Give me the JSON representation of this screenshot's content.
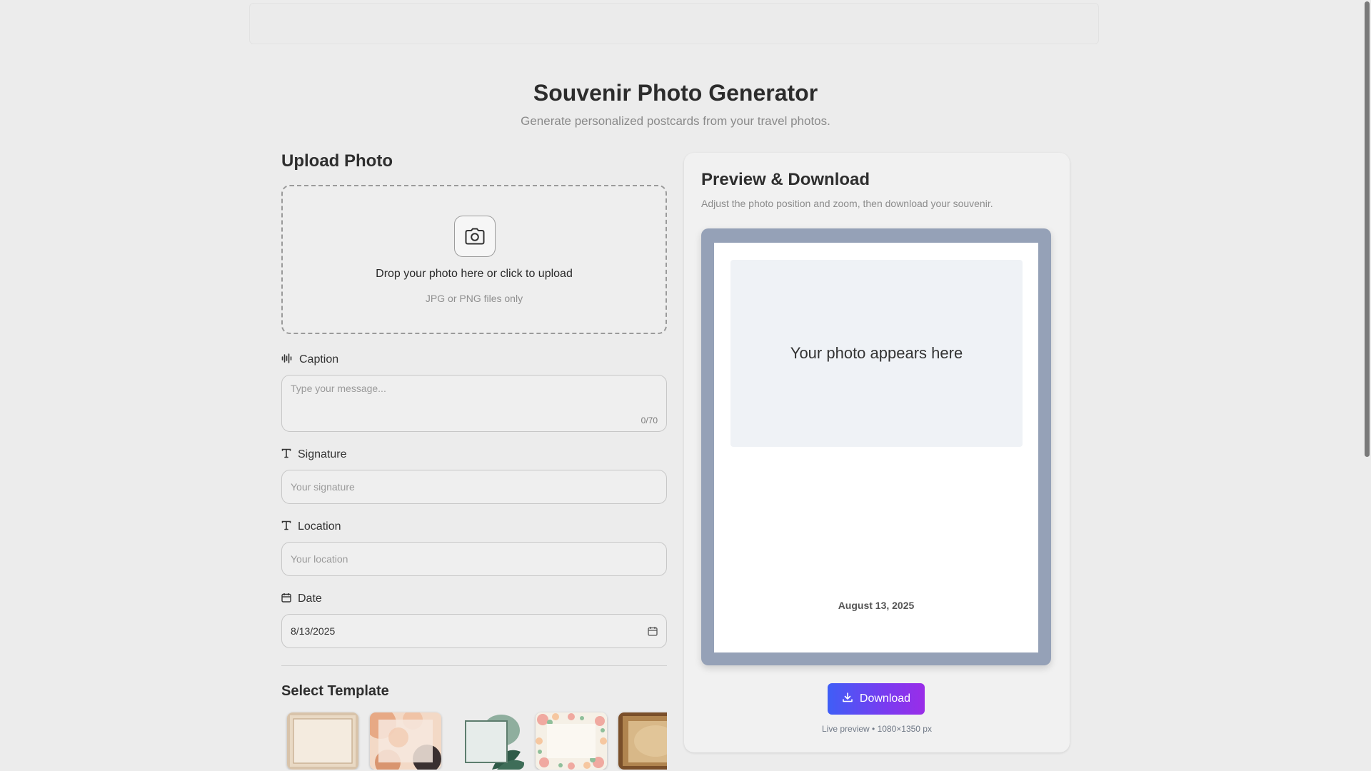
{
  "header": {
    "title": "Souvenir Photo Generator",
    "subtitle": "Generate personalized postcards from your travel photos."
  },
  "upload": {
    "heading": "Upload Photo",
    "dropzone_title": "Drop your photo here or click to upload",
    "dropzone_hint": "JPG or PNG files only"
  },
  "form": {
    "caption": {
      "label": "Caption",
      "placeholder": "Type your message...",
      "counter": "0/70"
    },
    "signature": {
      "label": "Signature",
      "placeholder": "Your signature"
    },
    "location": {
      "label": "Location",
      "placeholder": "Your location"
    },
    "date": {
      "label": "Date",
      "value": "8/13/2025"
    }
  },
  "templates": {
    "heading": "Select Template",
    "items": [
      "classic-cream",
      "watercolor-abstract",
      "tropical-leaves",
      "floral-border",
      "vintage-paper"
    ]
  },
  "preview": {
    "title": "Preview & Download",
    "subtitle": "Adjust the photo position and zoom, then download your souvenir.",
    "photo_placeholder": "Your photo appears here",
    "date_text": "August 13, 2025",
    "download_label": "Download",
    "note": "Live preview • 1080×1350 px",
    "frame_color": "#95a1b7"
  },
  "colors": {
    "background": "#ececec",
    "accent_start": "#3f5ef6",
    "accent_end": "#9a2de8"
  }
}
